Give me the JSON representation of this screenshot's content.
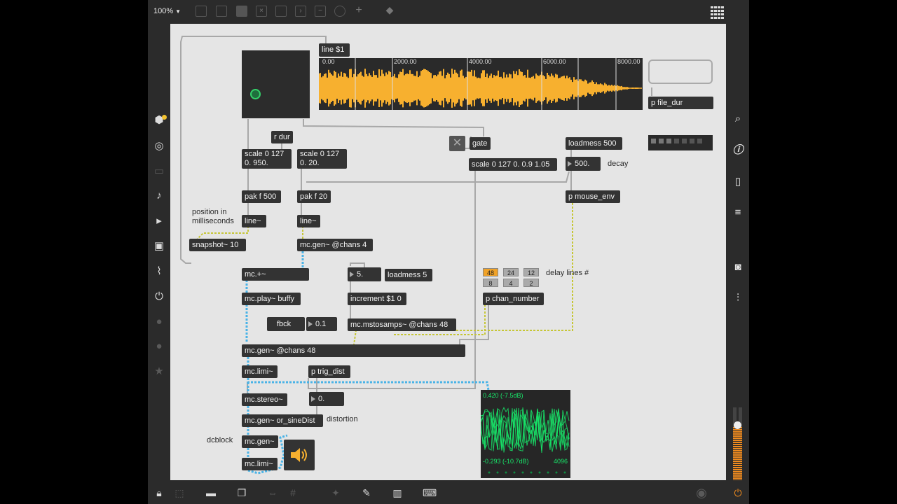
{
  "toolbar": {
    "zoom": "100%"
  },
  "objects": {
    "line_msg": "line $1",
    "r_dur": "r dur",
    "scale1_l1": "scale 0 127",
    "scale1_l2": "0. 950.",
    "scale2_l1": "scale 0 127",
    "scale2_l2": "0. 20.",
    "gate": "gate",
    "scale3": "scale 0 127 0. 0.9 1.05",
    "loadmess500": "loadmess 500",
    "num500": "500.",
    "pak1": "pak f 500",
    "pak2": "pak f 20",
    "line1": "line~",
    "line2": "line~",
    "snapshot": "snapshot~ 10",
    "mcgen4": "mc.gen~ @chans 4",
    "mcplus": "mc.+~",
    "num5": "5.",
    "loadmess5": "loadmess 5",
    "mcplay": "mc.play~ buffy",
    "increment": "increment $1 0",
    "fbck": "fbck",
    "num01": "0.1",
    "mcmstosamps": "mc.mstosamps~ @chans 48",
    "mcgen48": "mc.gen~ @chans 48",
    "mclimi1": "mc.limi~",
    "trigdist": "p trig_dist",
    "mcstereo": "mc.stereo~",
    "num0": "0.",
    "sinedist": "mc.gen~ or_sineDist",
    "mcgen": "mc.gen~",
    "mclimi2": "mc.limi~",
    "filedur": "p file_dur",
    "mouseenv": "p mouse_env",
    "chan_number": "p chan_number"
  },
  "comments": {
    "decay": "decay",
    "position": "position in",
    "ms": "milliseconds",
    "delaylines": "delay lines #",
    "distortion": "distortion",
    "dcblock": "dcblock"
  },
  "waveform": {
    "ticks": [
      "0.00",
      "2000.00",
      "4000.00",
      "6000.00",
      "8000.00"
    ]
  },
  "delay_tabs": [
    "48",
    "24",
    "12",
    "8",
    "4",
    "2"
  ],
  "scope": {
    "top": "0.420 (-7.5dB)",
    "bottom": "-0.293 (-10.7dB)",
    "count": "4096"
  },
  "colors": {
    "accent": "#f7b02f",
    "cable_signal": "#4ab3e6",
    "cable_mc": "#c6c636",
    "scope": "#18e86a"
  }
}
